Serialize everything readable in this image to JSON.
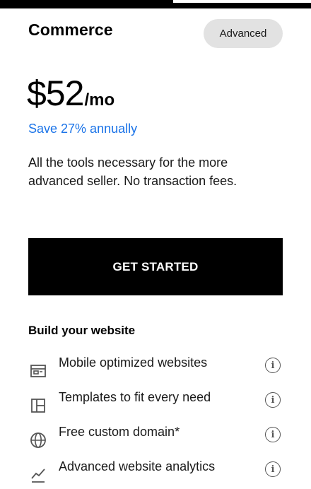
{
  "plan": {
    "name": "Commerce",
    "badge": "Advanced",
    "price": "$52",
    "price_unit": "/mo",
    "savings": "Save 27% annually",
    "description": "All the tools necessary for the more advanced seller. No transaction fees.",
    "cta_label": "GET STARTED"
  },
  "section": {
    "title": "Build your website"
  },
  "features": [
    {
      "label": "Mobile optimized websites",
      "icon": "browser-window-icon"
    },
    {
      "label": "Templates to fit every need",
      "icon": "layout-template-icon"
    },
    {
      "label": "Free custom domain*",
      "icon": "globe-icon"
    },
    {
      "label": "Advanced website analytics",
      "icon": "trend-line-icon"
    }
  ],
  "info_icon_glyph": "i",
  "colors": {
    "accent_link": "#1a73e8",
    "cta_background": "#000000",
    "badge_background": "#e2e2e2"
  }
}
